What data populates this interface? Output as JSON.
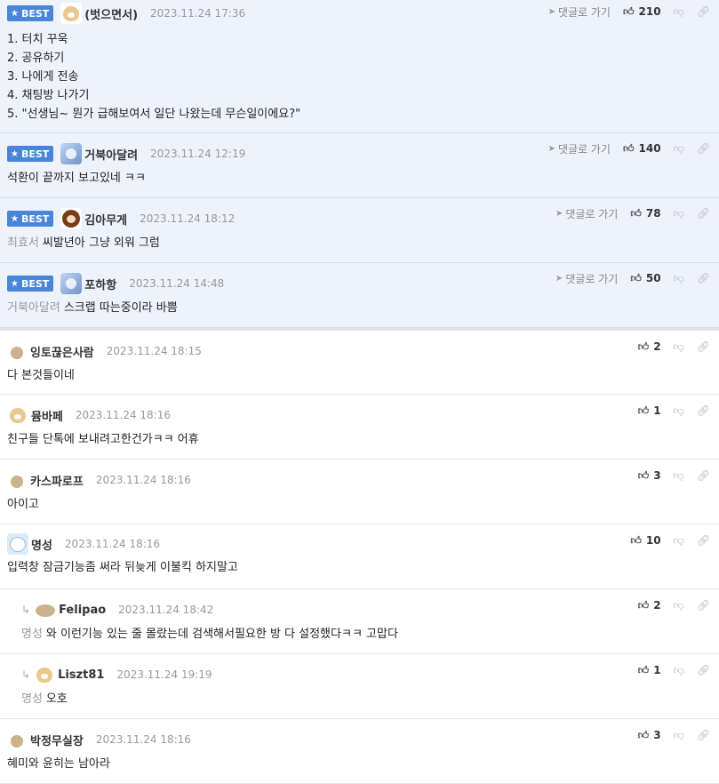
{
  "badge_label": "BEST",
  "goto_reply_label": "댓글로 가기",
  "best": [
    {
      "name": "(벗으면서)",
      "time": "2023.11.24 17:36",
      "likes": "210",
      "avatar": "dog",
      "lines": [
        "1. 터치 꾸욱",
        "2. 공유하기",
        "3. 나에게 전송",
        "4. 채팅방 나가기",
        "5. \"선생님~ 뭔가 급해보여서 일단 나왔는데 무슨일이에요?\""
      ],
      "mention": ""
    },
    {
      "name": "거북아달려",
      "time": "2023.11.24 12:19",
      "likes": "140",
      "avatar": "turtle",
      "lines": [
        "석환이 끝까지 보고있네 ㅋㅋ"
      ],
      "mention": ""
    },
    {
      "name": "김아무게",
      "time": "2023.11.24 18:12",
      "likes": "78",
      "avatar": "bear",
      "lines": [
        "씨발년아 그냥 외워 그럼"
      ],
      "mention": "최효서"
    },
    {
      "name": "포하항",
      "time": "2023.11.24 14:48",
      "likes": "50",
      "avatar": "turtle",
      "lines": [
        "스크랩 따는중이라 바쁨"
      ],
      "mention": "거북아달려"
    }
  ],
  "comments": [
    {
      "name": "잉토끊은사람",
      "time": "2023.11.24 18:15",
      "likes": "2",
      "avatar": "dot",
      "text": "다 본것들이네",
      "mention": "",
      "reply": false
    },
    {
      "name": "뮴바페",
      "time": "2023.11.24 18:16",
      "likes": "1",
      "avatar": "dog",
      "text": "친구들 단톡에 보내려고한건가ㅋㅋ 어휴",
      "mention": "",
      "reply": false
    },
    {
      "name": "카스파로프",
      "time": "2023.11.24 18:16",
      "likes": "3",
      "avatar": "dot",
      "text": "아이고",
      "mention": "",
      "reply": false
    },
    {
      "name": "명성",
      "time": "2023.11.24 18:16",
      "likes": "10",
      "avatar": "seal",
      "text": "입력창 잠금기능좀 써라 뒤늦게 이불킥 하지말고",
      "mention": "",
      "reply": false
    },
    {
      "name": "Felipao",
      "time": "2023.11.24 18:42",
      "likes": "2",
      "avatar": "dot-wide",
      "text": "와 이런기능 있는 줄 몰랐는데 검색해서필요한 방 다 설정했다ㅋㅋ 고맙다",
      "mention": "명성",
      "reply": true
    },
    {
      "name": "Liszt81",
      "time": "2023.11.24 19:19",
      "likes": "1",
      "avatar": "dog",
      "text": "오호",
      "mention": "명성",
      "reply": true
    },
    {
      "name": "박정무실장",
      "time": "2023.11.24 18:16",
      "likes": "3",
      "avatar": "dot",
      "text": "혜미와 윤히는 남아라",
      "mention": "",
      "reply": false
    }
  ]
}
